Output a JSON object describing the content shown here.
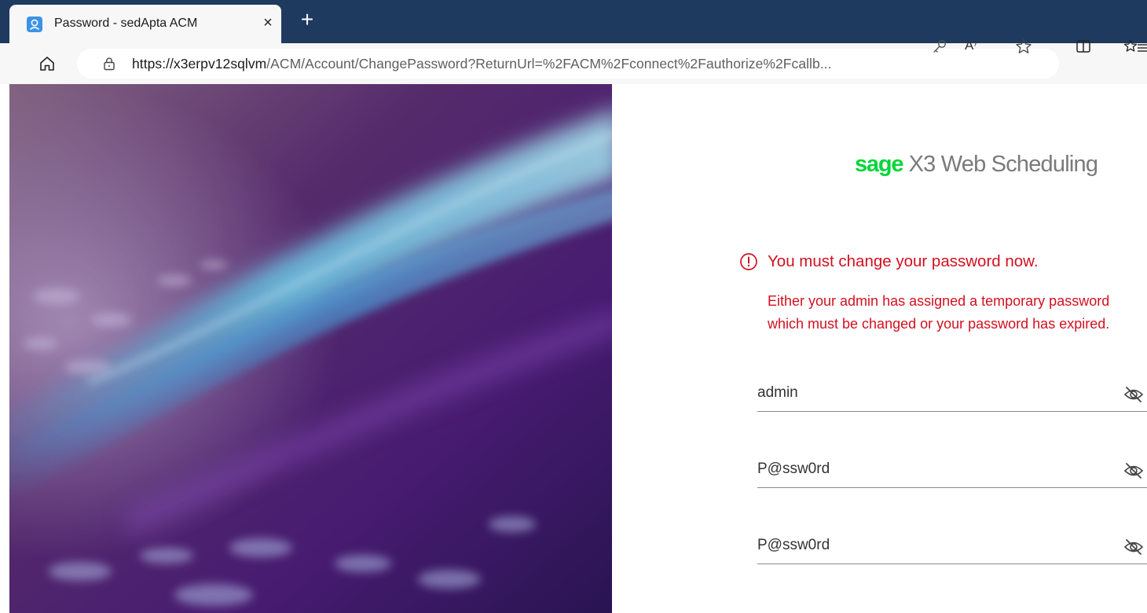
{
  "browser": {
    "tab": {
      "title": "Password - sedApta ACM",
      "close_glyph": "×",
      "favicon": "user-profile-icon"
    },
    "new_tab_glyph": "+",
    "address_bar": {
      "url_host": "https://x3erpv12sqlvm",
      "url_rest": "/ACM/Account/ChangePassword?ReturnUrl=%2FACM%2Fconnect%2Fauthorize%2Fcallb..."
    },
    "read_aloud_glyph": "A⁾",
    "icons": [
      "home-icon",
      "lock-icon",
      "key-icon",
      "read-aloud-icon",
      "star-icon",
      "split-screen-icon",
      "favorites-icon"
    ]
  },
  "page": {
    "logo": {
      "brand": "sage",
      "product": " X3 Web Scheduling",
      "brand_color": "#00d639"
    },
    "error": {
      "title": "You must change your password now.",
      "line1": "Either your admin has assigned a temporary password",
      "line2": "which must be changed or your password has expired.",
      "color": "#d3101f"
    },
    "fields": [
      {
        "value": "admin",
        "icon": "eye-hidden-icon"
      },
      {
        "value": "P@ssw0rd",
        "icon": "eye-hidden-icon"
      },
      {
        "value": "P@ssw0rd",
        "icon": "eye-hidden-icon"
      }
    ]
  }
}
